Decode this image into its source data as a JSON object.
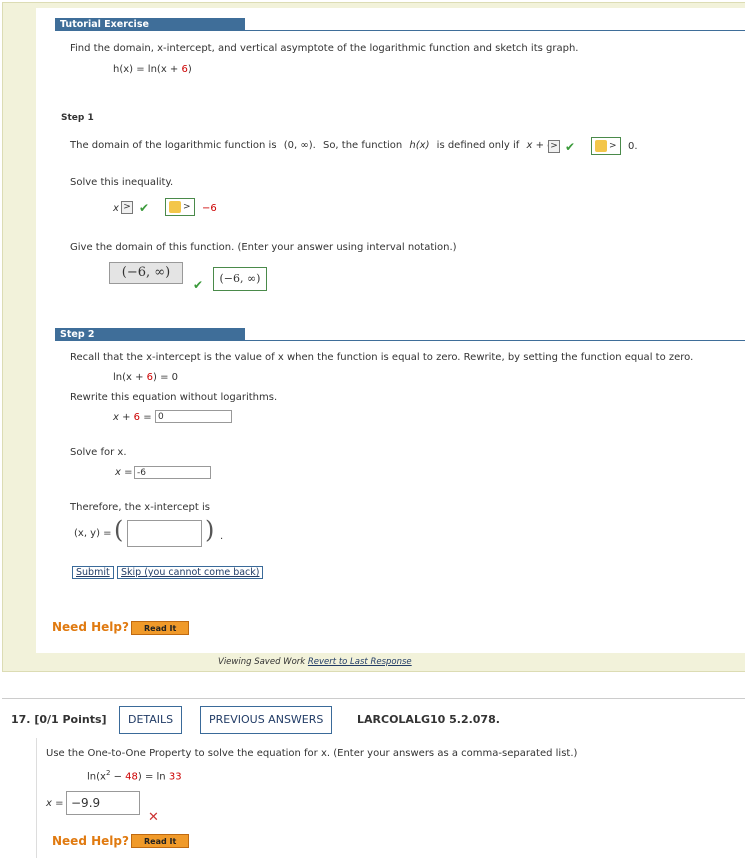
{
  "tutorial": {
    "header": "Tutorial Exercise",
    "prompt": "Find the domain, x-intercept, and vertical asymptote of the logarithmic function and sketch its graph.",
    "func_lhs": "h(x) = ln(x + ",
    "func_six": "6",
    "func_rhs": ")"
  },
  "step1": {
    "header": "Step 1",
    "domain_text_a": "The domain of the logarithmic function is",
    "domain_interval": "(0, ∞).",
    "domain_text_b": "So, the function",
    "hx": "h(x)",
    "domain_text_c": "is defined only if",
    "cond_expr": "x + 6",
    "op_box": ">",
    "key_op": ">",
    "zero": "0.",
    "solve_label": "Solve this inequality.",
    "x_var": "x",
    "ineq_box": ">",
    "ineq_key_op": ">",
    "neg_six": "−6",
    "domain_prompt": "Give the domain of this function. (Enter your answer using interval notation.)",
    "domain_answer": "(−6, ∞)",
    "domain_correct": "(−6, ∞)"
  },
  "step2": {
    "header": "Step 2",
    "recall_text": "Recall that the x-intercept is the value of x when the function is equal to zero. Rewrite, by setting the function equal to zero.",
    "eq_lhs": "ln(x + ",
    "eq_six": "6",
    "eq_rhs": ") = 0",
    "rewrite_label": "Rewrite this equation without logarithms.",
    "rw_lhs": "x + ",
    "rw_six": "6",
    "rw_eq": " =",
    "rw_value": "0",
    "solve_label": "Solve for x.",
    "x_eq": "x =",
    "x_value": "-6",
    "therefore": "Therefore, the x-intercept is",
    "xy_label": "(x, y) =",
    "xy_value": "",
    "submit": "Submit",
    "skip": "Skip (you cannot come back)"
  },
  "help": {
    "need_help": "Need Help?",
    "read_it": "Read It",
    "viewing": "Viewing Saved Work",
    "revert": "Revert to Last Response"
  },
  "q17": {
    "number": "17.  [0/1 Points]",
    "details": "DETAILS",
    "previous": "PREVIOUS ANSWERS",
    "code": "LARCOLALG10 5.2.078.",
    "prompt": "Use the One-to-One Property to solve the equation for x. (Enter your answers as a comma-separated list.)",
    "eq_a": "ln(x",
    "eq_sup": "2",
    "eq_b": " − ",
    "eq_48": "48",
    "eq_c": ") = ln ",
    "eq_33": "33",
    "x_label": "x =",
    "answer": "−9.9",
    "need_help": "Need Help?",
    "read_it": "Read It"
  },
  "colors": {
    "header_blue": "#3f6e99",
    "panel": "#f2f2da",
    "help_orange": "#e07a10",
    "correct": "#3a9a3a",
    "wrong": "#cc3333"
  }
}
